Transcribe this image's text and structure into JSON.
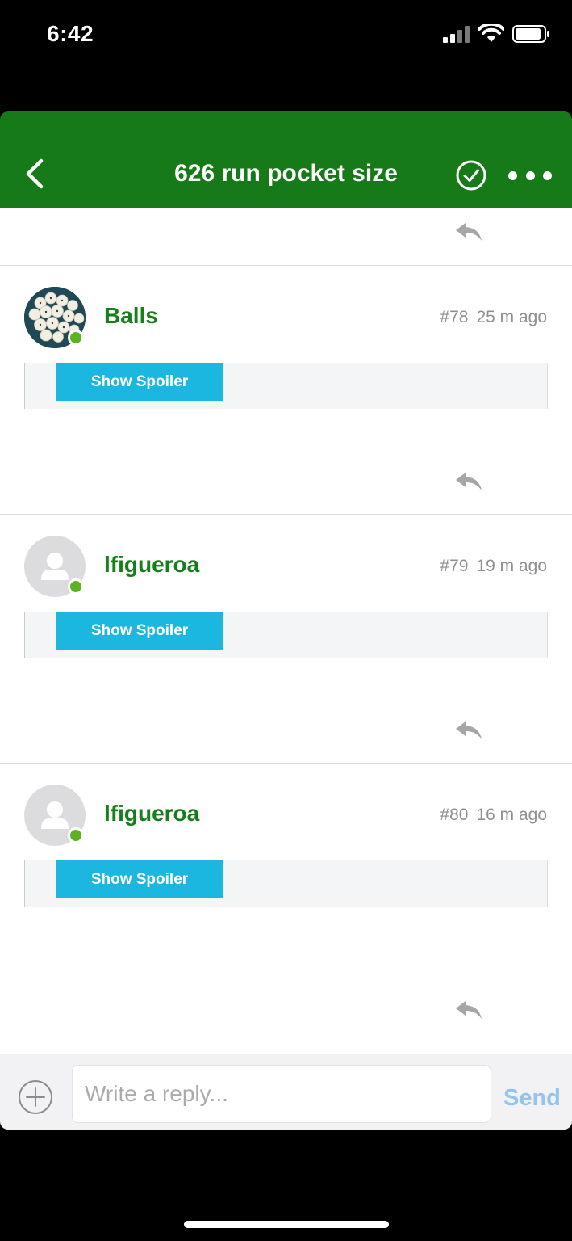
{
  "status_bar": {
    "time": "6:42"
  },
  "nav": {
    "title": "626 run pocket size"
  },
  "posts": [
    {
      "username": "Balls",
      "number": "#78",
      "time": "25 m ago",
      "spoiler_label": "Show Spoiler"
    },
    {
      "username": "lfigueroa",
      "number": "#79",
      "time": "19 m ago",
      "spoiler_label": "Show Spoiler"
    },
    {
      "username": "lfigueroa",
      "number": "#80",
      "time": "16 m ago",
      "spoiler_label": "Show Spoiler"
    }
  ],
  "composer": {
    "placeholder": "Write a reply...",
    "send_label": "Send"
  },
  "colors": {
    "header": "#157a17",
    "username": "#15801a",
    "spoiler": "#1cb7e0",
    "online": "#5ab31f",
    "send": "#93c5f0"
  }
}
